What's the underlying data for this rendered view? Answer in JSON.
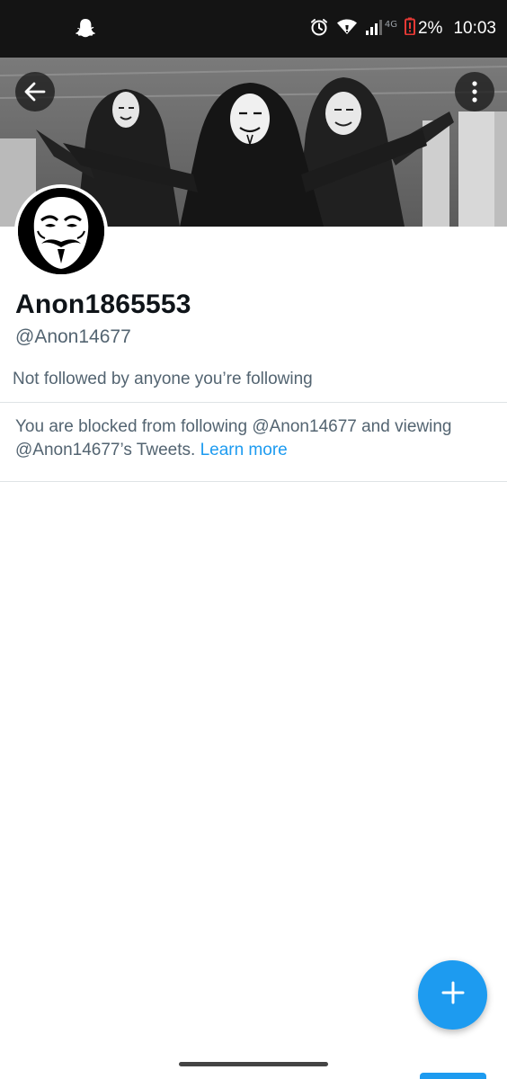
{
  "status_bar": {
    "left_icon": "snapchat-ghost-icon",
    "alarm_icon": "alarm-icon",
    "wifi_icon": "wifi-icon",
    "signal_icon": "signal-icon",
    "network_label": "4G",
    "battery_icon": "battery-low-icon",
    "battery_percent": "2%",
    "time": "10:03"
  },
  "header": {
    "back_icon": "arrow-left-icon",
    "more_icon": "more-vertical-icon"
  },
  "profile": {
    "display_name": "Anon1865553",
    "handle": "@Anon14677",
    "followed_note": "Not followed by anyone you’re following"
  },
  "blocked_notice": {
    "text": "You are blocked from following @Anon14677 and viewing @Anon14677’s Tweets.",
    "link_label": "Learn more"
  },
  "compose": {
    "icon": "plus-icon"
  },
  "colors": {
    "accent": "#1d9bf0",
    "status_bar_bg": "#141414",
    "battery_warning": "#e53935",
    "secondary_text": "#536471"
  }
}
